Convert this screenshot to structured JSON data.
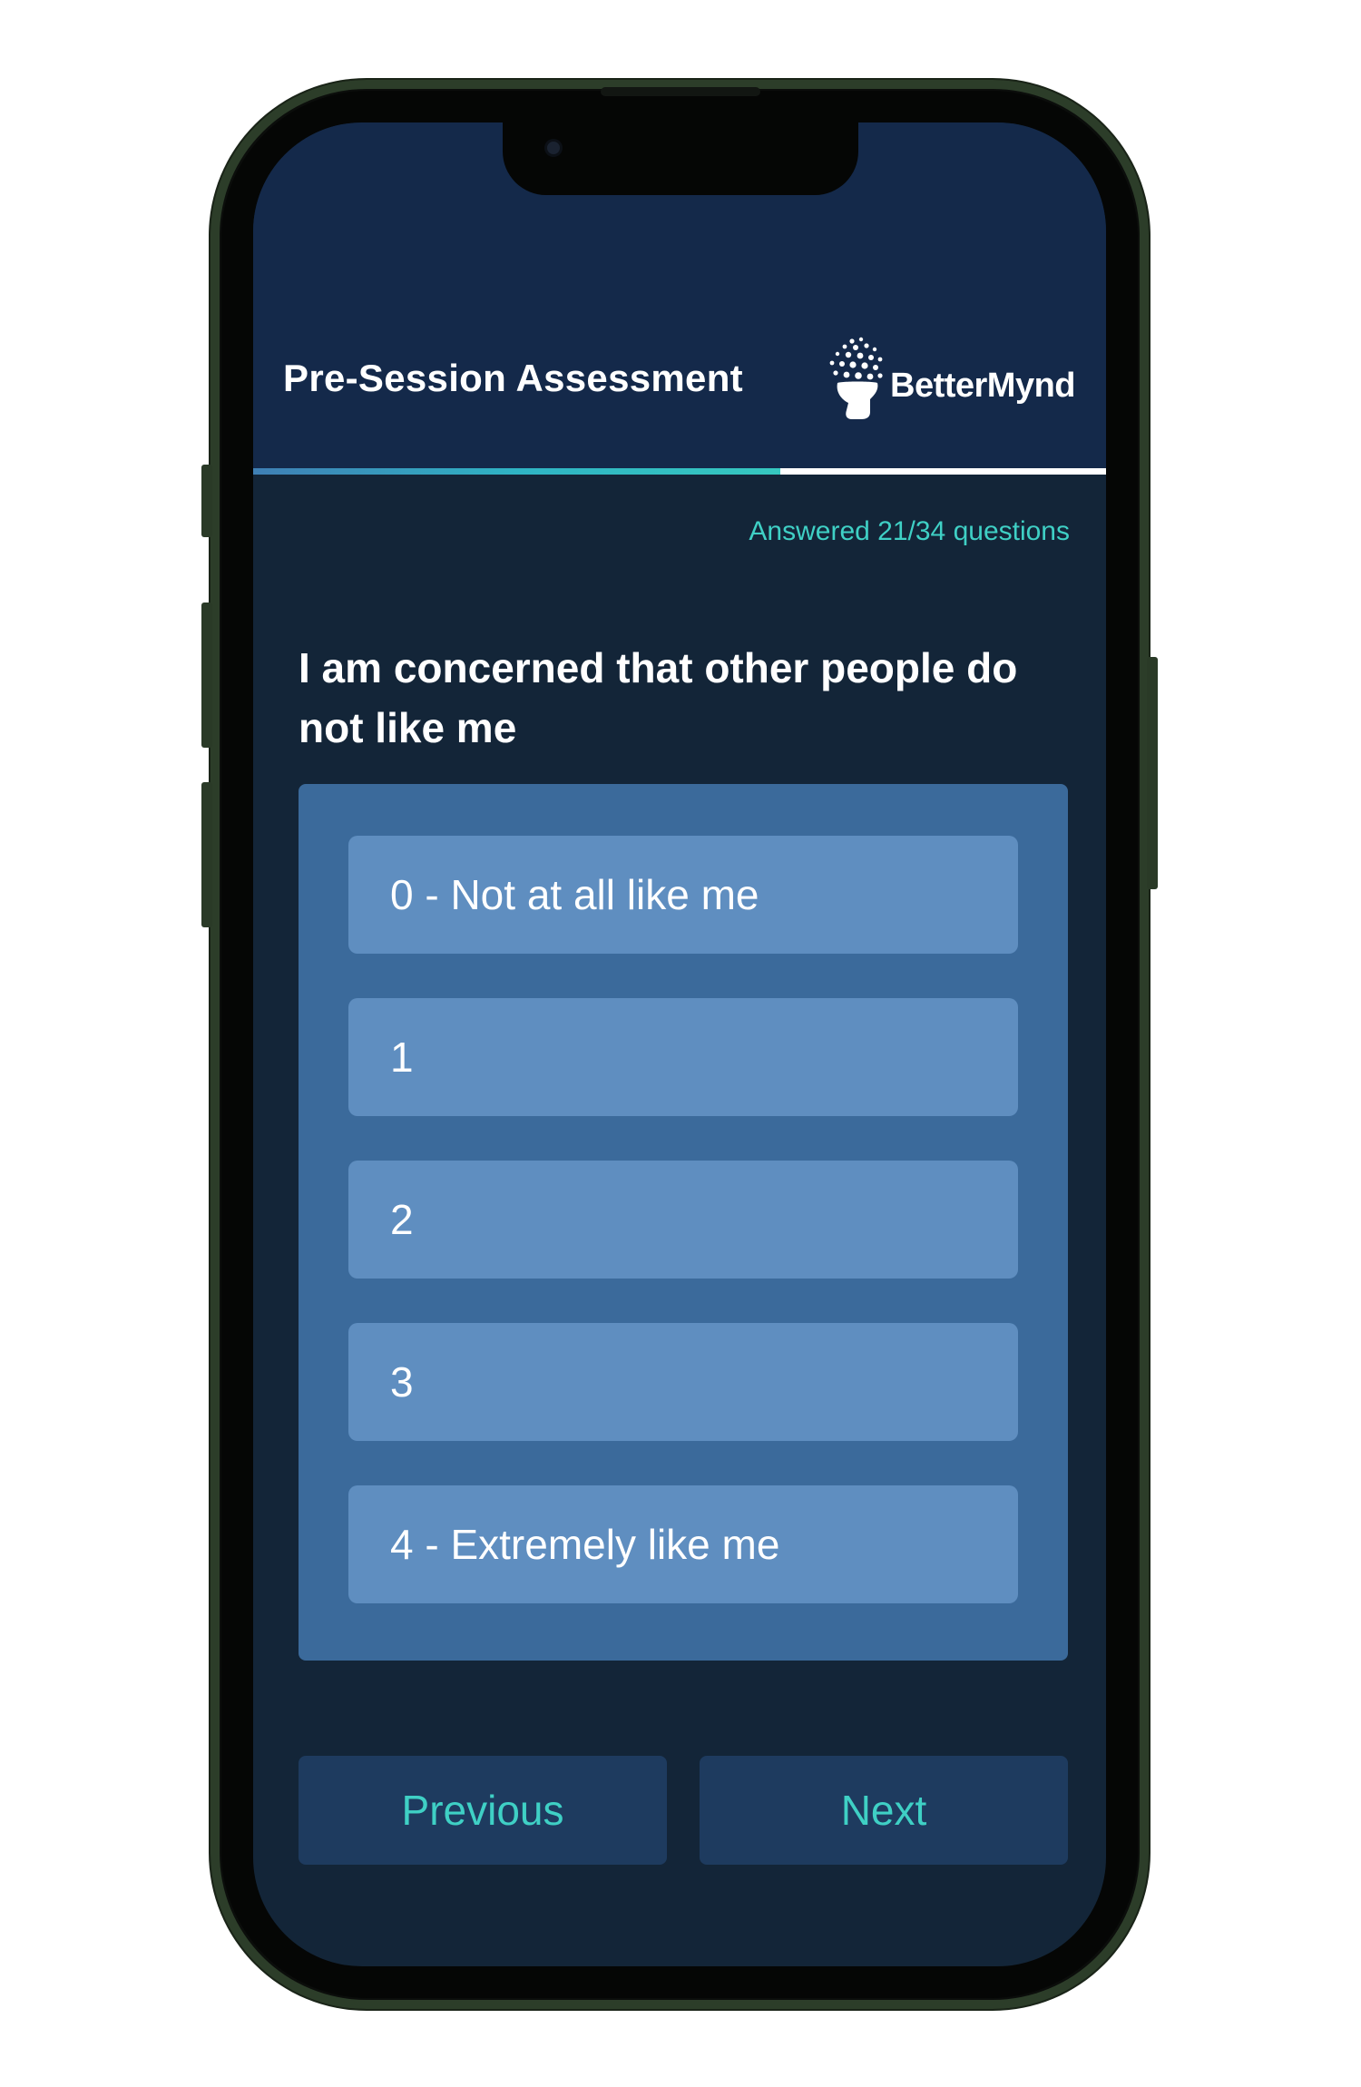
{
  "header": {
    "title": "Pre-Session Assessment",
    "brand": "BetterMynd",
    "logo_icon": "head-bubbles-logo-icon"
  },
  "progress": {
    "answered": 21,
    "total": 34,
    "fraction": 0.6176,
    "label": "Answered 21/34 questions"
  },
  "question": {
    "text": "I am concerned that other people do not like me"
  },
  "options": [
    {
      "label": "0 - Not at all like me"
    },
    {
      "label": "1"
    },
    {
      "label": "2"
    },
    {
      "label": "3"
    },
    {
      "label": "4 - Extremely like me"
    }
  ],
  "nav": {
    "previous_label": "Previous",
    "next_label": "Next"
  },
  "colors": {
    "background": "#132538",
    "header": "#14294a",
    "accent": "#3fd0c5",
    "panel": "#3b6a9b",
    "option": "#5f8ec0",
    "nav_button": "#1e3b5f"
  }
}
